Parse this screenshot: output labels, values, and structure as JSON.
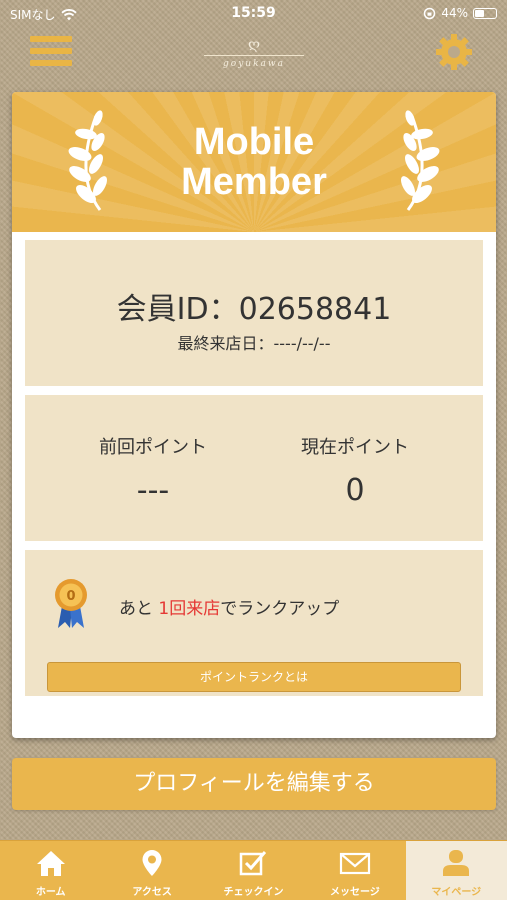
{
  "status": {
    "carrier": "SIMなし",
    "time": "15:59",
    "battery": "44%",
    "icons": [
      "wifi-icon",
      "orientation-lock-icon",
      "battery-icon"
    ]
  },
  "header": {
    "logo_mark": "ღ",
    "logo_name": "goyukawa",
    "icons": [
      "menu-icon",
      "gear-icon"
    ]
  },
  "card": {
    "title_line1": "Mobile",
    "title_line2": "Member",
    "member_id": "会員ID：02658841",
    "last_visit": "最終来店日：----/--/--",
    "previous_points_label": "前回ポイント",
    "previous_points_value": "---",
    "current_points_label": "現在ポイント",
    "current_points_value": "0",
    "rank_prefix": "あと ",
    "rank_highlight": "1回来店",
    "rank_suffix": "でランクアップ",
    "rank_medal_value": "0",
    "rank_button": "ポイントランクとは"
  },
  "edit_profile_button": "プロフィールを編集する",
  "tabs": [
    {
      "label": "ホーム",
      "icon": "home-icon"
    },
    {
      "label": "アクセス",
      "icon": "map-pin-icon"
    },
    {
      "label": "チェックイン",
      "icon": "checkbox-icon"
    },
    {
      "label": "メッセージ",
      "icon": "mail-icon"
    },
    {
      "label": "マイページ",
      "icon": "user-icon",
      "active": true
    }
  ],
  "colors": {
    "accent": "#eab64d",
    "panel": "#f0e3c7",
    "highlight": "#e53935",
    "background": "#b9a88a"
  }
}
